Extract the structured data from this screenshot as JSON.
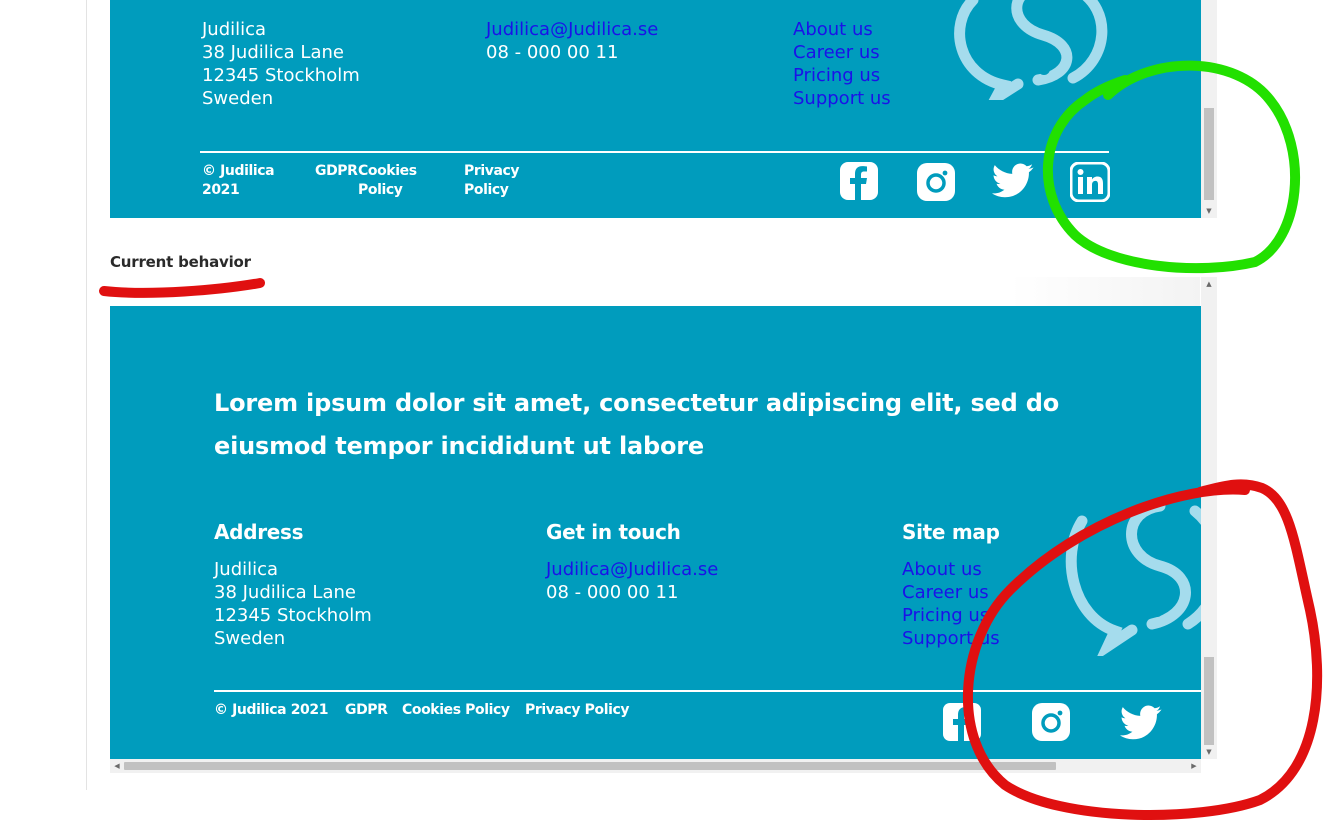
{
  "expected": {
    "address": {
      "lines": [
        "Judilica",
        "38 Judilica Lane",
        "12345 Stockholm",
        "Sweden"
      ]
    },
    "contact": {
      "email": "Judilica@Judilica.se",
      "phone": "08 - 000 00 11"
    },
    "sitemap": {
      "links": [
        "About us",
        "Career us",
        "Pricing us",
        "Support us"
      ]
    },
    "footer": {
      "copyright_line1": "© Judilica",
      "copyright_line2": "2021",
      "gdpr": "GDPR",
      "cookies_line1": "Cookies",
      "cookies_line2": "Policy",
      "privacy_line1": "Privacy",
      "privacy_line2": "Policy"
    },
    "social": [
      "facebook-icon",
      "instagram-icon",
      "twitter-icon",
      "linkedin-icon"
    ]
  },
  "caption": "Current behavior",
  "current": {
    "headline_line1": "Lorem ipsum dolor sit amet, consectetur adipiscing elit, sed do",
    "headline_line2": "eiusmod tempor incididunt ut labore",
    "address": {
      "heading": "Address",
      "lines": [
        "Judilica",
        "38 Judilica Lane",
        "12345 Stockholm",
        "Sweden"
      ]
    },
    "contact": {
      "heading": "Get in touch",
      "email": "Judilica@Judilica.se",
      "phone": "08 - 000 00 11"
    },
    "sitemap": {
      "heading": "Site map",
      "links": [
        "About us",
        "Career us",
        "Pricing us",
        "Support us"
      ]
    },
    "footer": {
      "copyright": "© Judilica 2021",
      "gdpr": "GDPR",
      "cookies": "Cookies Policy",
      "privacy": "Privacy Policy"
    },
    "social": [
      "facebook-icon",
      "instagram-icon",
      "twitter-icon"
    ]
  },
  "colors": {
    "footer_bg": "#009cbd",
    "link": "#1a12e8",
    "logo": "#a5dced",
    "annotation_green": "#22e000",
    "annotation_red": "#e01010"
  }
}
